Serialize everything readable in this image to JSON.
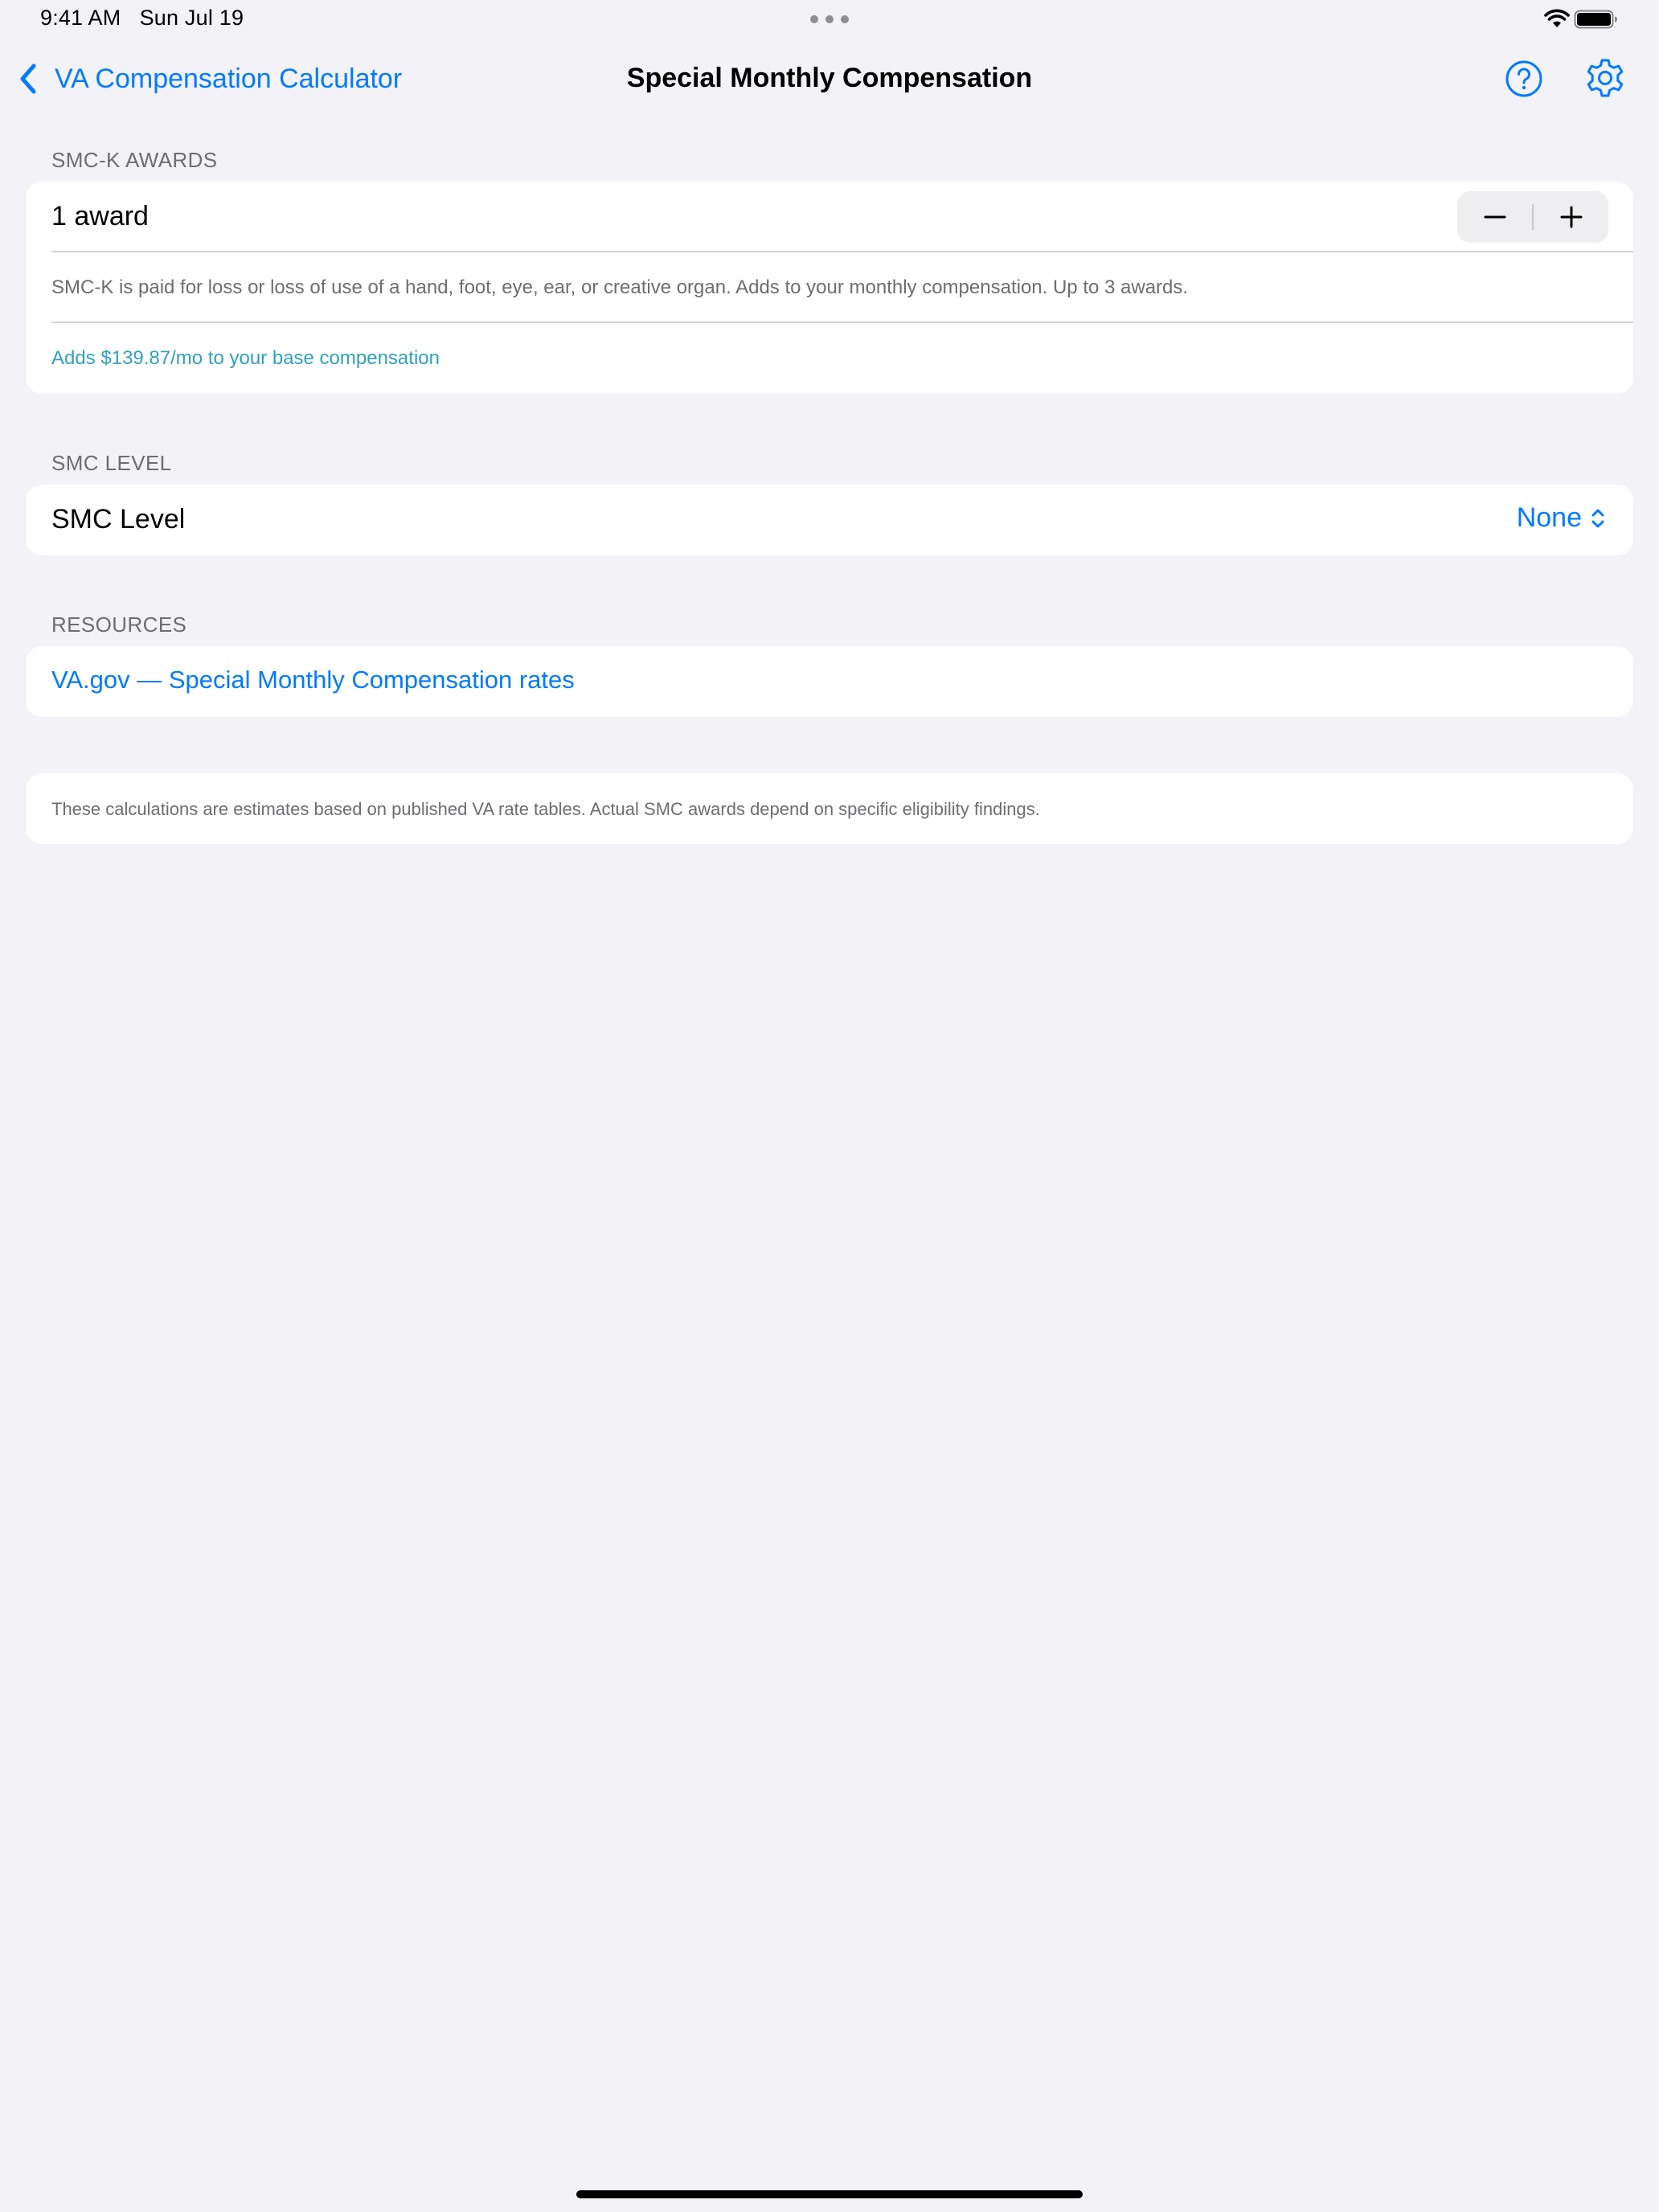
{
  "status_bar": {
    "time": "9:41 AM",
    "date": "Sun Jul 19"
  },
  "nav": {
    "back_label": "VA Compensation Calculator",
    "title": "Special Monthly Compensation",
    "help_icon": "question-circle-icon",
    "settings_icon": "gear-icon"
  },
  "smck": {
    "header": "SMC-K AWARDS",
    "award_count": "1 award",
    "stepper_value": 1,
    "stepper_max": 3,
    "info": "SMC-K is paid for loss or loss of use of a hand, foot, eye, ear, or creative organ. Adds to your monthly compensation. Up to 3 awards.",
    "adds": "Adds $139.87/mo to your base compensation"
  },
  "smc_level": {
    "header": "SMC LEVEL",
    "label": "SMC Level",
    "value": "None"
  },
  "resources": {
    "header": "RESOURCES",
    "link": "VA.gov — Special Monthly Compensation rates"
  },
  "disclaimer": {
    "text": "These calculations are estimates based on published VA rate tables. Actual SMC awards depend on specific eligibility findings."
  },
  "colors": {
    "accent": "#007aff",
    "background": "#f2f2f7",
    "secondary_text": "#6d6d72",
    "teal_text": "#30a0c0"
  }
}
